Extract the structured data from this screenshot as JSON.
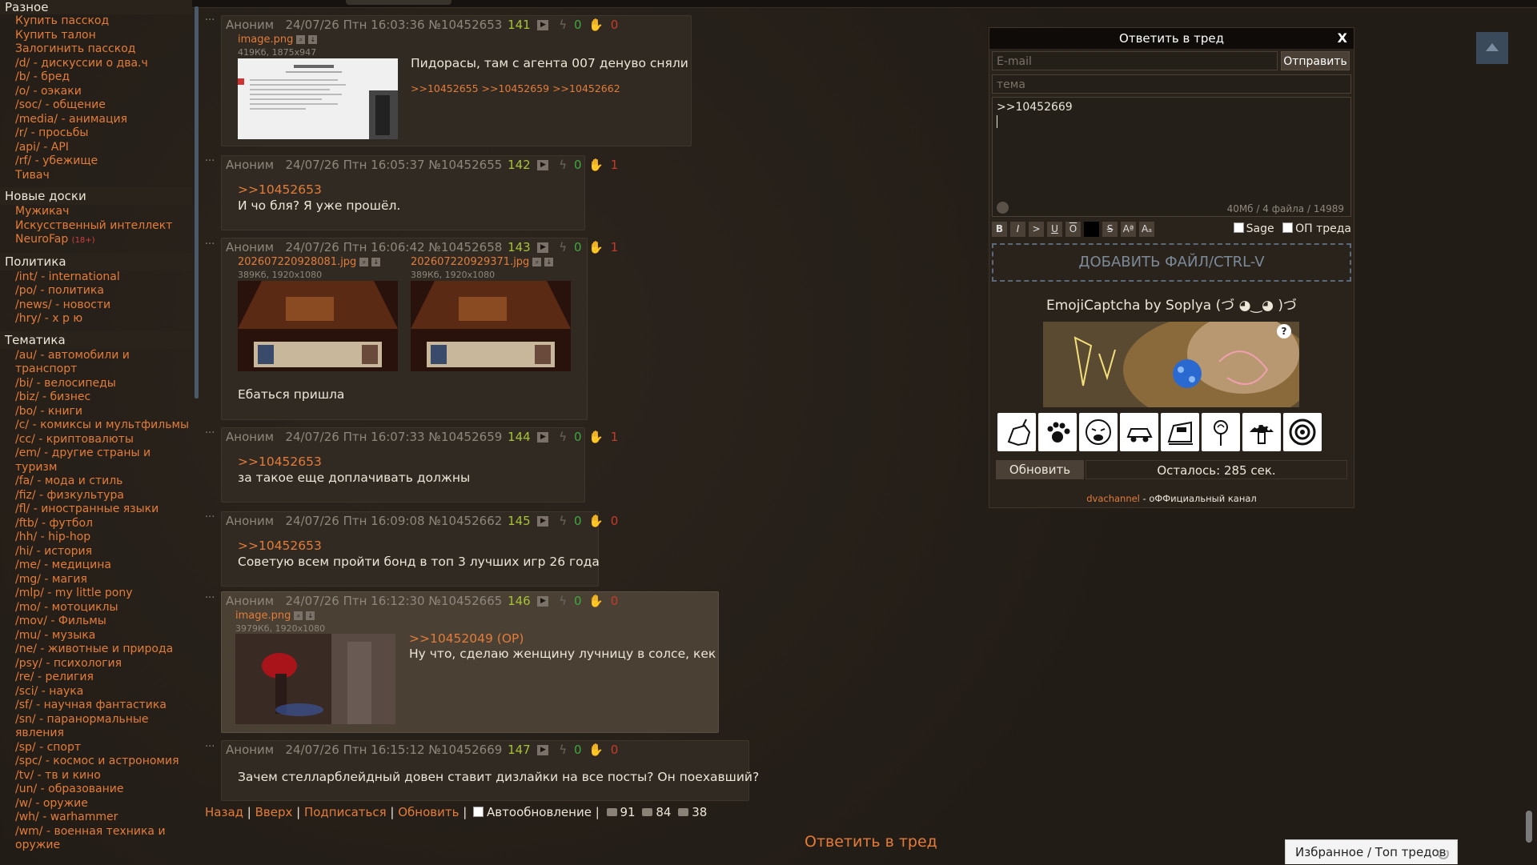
{
  "sidebar": {
    "sections": [
      {
        "title": "Разное",
        "items": [
          "Купить пасскод",
          "Купить талон",
          "Залогинить пасскод",
          "/d/ - дискуссии о два.ч",
          "/b/ - бред",
          "/o/ - оэкаки",
          "/soc/ - общение",
          "/media/ - анимация",
          "/r/ - просьбы",
          "/api/ - API",
          "/rf/ - убежище",
          "Тивач"
        ]
      },
      {
        "title": "Новые доски",
        "items": [
          "Мужикач",
          "Искусственный интеллект",
          "NeuroFap"
        ],
        "tag18": "(18+)"
      },
      {
        "title": "Политика",
        "items": [
          "/int/ - international",
          "/po/ - политика",
          "/news/ - новости",
          "/hry/ - х р ю"
        ]
      },
      {
        "title": "Тематика",
        "items": [
          "/au/ - автомобили и транспорт",
          "/bi/ - велосипеды",
          "/biz/ - бизнес",
          "/bo/ - книги",
          "/c/ - комиксы и мультфильмы",
          "/cc/ - криптовалюты",
          "/em/ - другие страны и",
          "туризм",
          "/fa/ - мода и стиль",
          "/fiz/ - физкультура",
          "/fl/ - иностранные языки",
          "/ftb/ - футбол",
          "/hh/ - hip-hop",
          "/hi/ - история",
          "/me/ - медицина",
          "/mg/ - магия",
          "/mlp/ - my little pony",
          "/mo/ - мотоциклы",
          "/mov/ - Фильмы",
          "/mu/ - музыка",
          "/ne/ - животные и природа",
          "/psy/ - психология",
          "/re/ - религия",
          "/sci/ - наука",
          "/sf/ - научная фантастика",
          "/sn/ - паранормальные",
          "явления",
          "/sp/ - спорт",
          "/spc/ - космос и астрономия",
          "/tv/ - тв и кино",
          "/un/ - образование",
          "/w/ - оружие",
          "/wh/ - warhammer",
          "/wm/ - военная техника и",
          "оружие"
        ]
      }
    ]
  },
  "posts": [
    {
      "author": "Аноним",
      "date": "24/07/26 Птн 16:03:36",
      "num": "№10452653",
      "count": "141",
      "likes": "0",
      "dislikes": "0",
      "file1": {
        "name": "image.png",
        "meta": "419Кб, 1875x947"
      },
      "text": "Пидорасы, там с агента 007 денуво сняли",
      "backlinks": ">>10452655 >>10452659 >>10452662"
    },
    {
      "author": "Аноним",
      "date": "24/07/26 Птн 16:05:37",
      "num": "№10452655",
      "count": "142",
      "likes": "0",
      "dislikes": "1",
      "reply": ">>10452653",
      "text": "И чо бля? Я уже прошёл."
    },
    {
      "author": "Аноним",
      "date": "24/07/26 Птн 16:06:42",
      "num": "№10452658",
      "count": "143",
      "likes": "0",
      "dislikes": "1",
      "file1": {
        "name": "202607220928081.jpg",
        "meta": "389Кб, 1920x1080"
      },
      "file2": {
        "name": "202607220929371.jpg",
        "meta": "389Кб, 1920x1080"
      },
      "text": "Ебаться пришла"
    },
    {
      "author": "Аноним",
      "date": "24/07/26 Птн 16:07:33",
      "num": "№10452659",
      "count": "144",
      "likes": "0",
      "dislikes": "1",
      "reply": ">>10452653",
      "text": "за такое еще доплачивать должны"
    },
    {
      "author": "Аноним",
      "date": "24/07/26 Птн 16:09:08",
      "num": "№10452662",
      "count": "145",
      "likes": "0",
      "dislikes": "0",
      "reply": ">>10452653",
      "text": "Советую всем пройти бонд в топ 3 лучших игр 26 года"
    },
    {
      "author": "Аноним",
      "date": "24/07/26 Птн 16:12:30",
      "num": "№10452665",
      "count": "146",
      "likes": "0",
      "dislikes": "0",
      "file1": {
        "name": "image.png",
        "meta": "3979Кб, 1920x1080"
      },
      "reply": ">>10452049 (OP)",
      "text": "Ну что, сделаю женщину лучницу в солсе, кек"
    },
    {
      "author": "Аноним",
      "date": "24/07/26 Птн 16:15:12",
      "num": "№10452669",
      "count": "147",
      "likes": "0",
      "dislikes": "0",
      "text": "Зачем стелларблейдный довен ставит дизлайки на все посты? Он поехавший?"
    }
  ],
  "bottom": {
    "back": "Назад",
    "up": "Вверх",
    "subscribe": "Подписаться",
    "refresh": "Обновить",
    "autoupdate": "Автообновление",
    "posts_count": "91",
    "images_count": "84",
    "users_count": "38",
    "reply_thread": "Ответить в тред"
  },
  "reply_form": {
    "title": "Ответить в тред",
    "close": "X",
    "email_placeholder": "E-mail",
    "send": "Отправить",
    "topic_placeholder": "тема",
    "message": ">>10452669",
    "limits": "40Мб / 4 файла / 14989",
    "format_buttons": [
      "B",
      "I",
      ">",
      "U",
      "O",
      "",
      "S",
      "Aª",
      "Aₐ"
    ],
    "sage": "Sage",
    "op": "ОП треда",
    "dropzone": "ДОБАВИТЬ ФАЙЛ/CTRL-V",
    "captcha_title": "EmojiCaptcha by Soplya (づ ◕‿◕ )づ",
    "captcha_help": "?",
    "emoji_icons": [
      "goat-icon",
      "paw-icon",
      "sneeze-face-icon",
      "car-icon",
      "train-icon",
      "rose-icon",
      "mushroom-icon",
      "disc-icon"
    ],
    "refresh": "Обновить",
    "remaining": "Осталось: 285 сек.",
    "channel_link": "dvachannel",
    "channel_text": " - оФФициальный канал"
  },
  "favbar": "Избранное / Топ тредов"
}
